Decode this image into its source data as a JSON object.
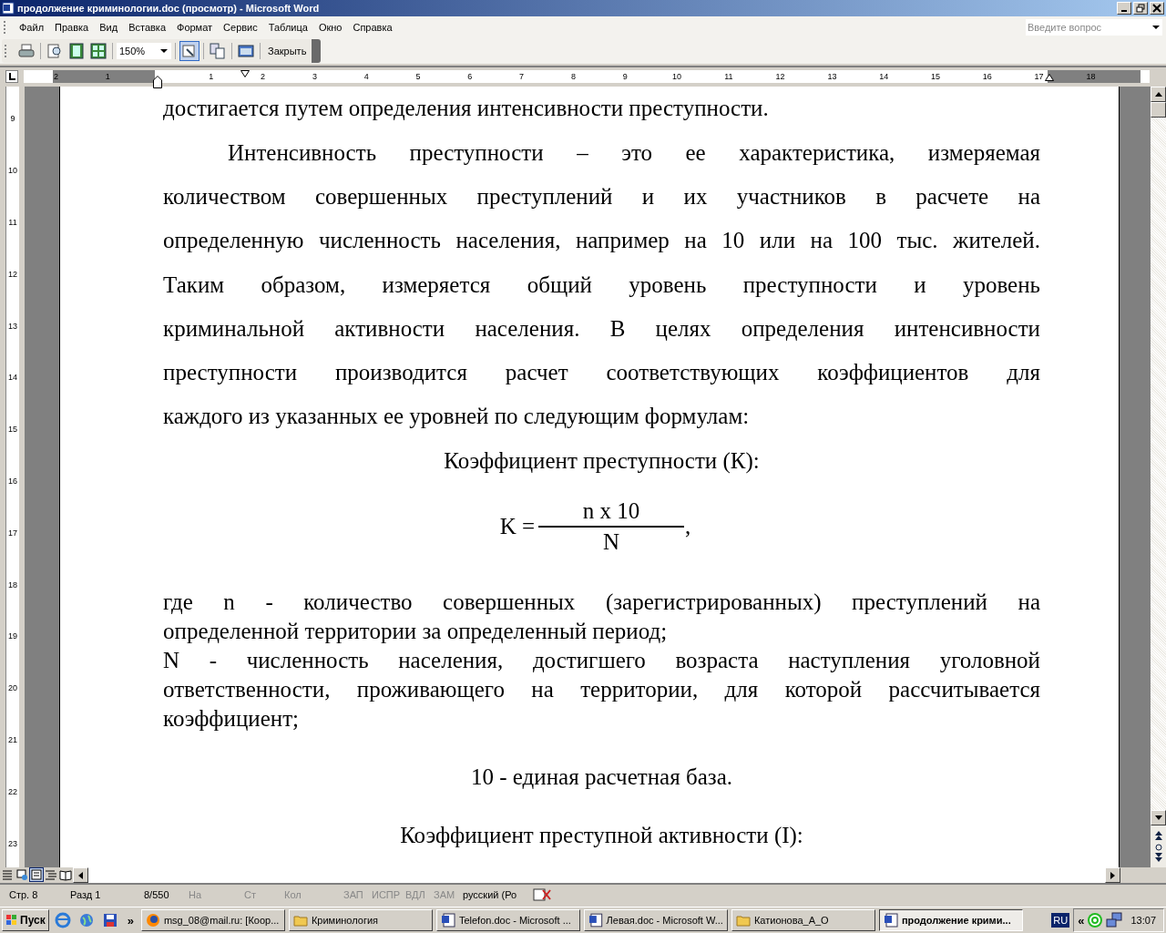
{
  "window": {
    "title": "продолжение криминологии.doc (просмотр) - Microsoft Word"
  },
  "menu": [
    {
      "label": "Файл"
    },
    {
      "label": "Правка"
    },
    {
      "label": "Вид"
    },
    {
      "label": "Вставка"
    },
    {
      "label": "Формат"
    },
    {
      "label": "Сервис"
    },
    {
      "label": "Таблица"
    },
    {
      "label": "Окно"
    },
    {
      "label": "Справка"
    }
  ],
  "help_box": {
    "placeholder": "Введите вопрос"
  },
  "toolbar": {
    "zoom": "150%",
    "magnifier_on": true,
    "close_label": "Закрыть"
  },
  "ruler": {
    "left_labels": [
      "2",
      "1"
    ],
    "labels": [
      "1",
      "2",
      "3",
      "4",
      "5",
      "6",
      "7",
      "8",
      "9",
      "10",
      "11",
      "12",
      "13",
      "14",
      "15",
      "16",
      "17"
    ],
    "right_labels": [
      "18"
    ],
    "vertical_labels": [
      "9",
      "10",
      "11",
      "12",
      "13",
      "14",
      "15",
      "16",
      "17",
      "18",
      "19",
      "20",
      "21",
      "22",
      "23"
    ]
  },
  "document": [
    {
      "kind": "continuation",
      "lines": [
        "достигается путем определения интенсивности преступности."
      ]
    },
    {
      "kind": "paragraph",
      "lines": [
        "Интенсивность преступности – это ее характеристика, измеряемая",
        "количеством совершенных преступлений и их участников в расчете на",
        "определенную численность населения, например на 10 или на 100 тыс. жителей.",
        "Таким образом, измеряется общий уровень преступности и уровень",
        "криминальной активности населения. В целях определения интенсивности",
        "преступности производится расчет соответствующих коэффициентов для",
        "каждого из указанных ее уровней по следующим формулам:"
      ]
    },
    {
      "kind": "heading",
      "text": "Коэффициент преступности (К):"
    },
    {
      "kind": "formula",
      "lhs": "K =",
      "numerator": "n x 10",
      "denominator": "N",
      "tail": ","
    },
    {
      "kind": "definition",
      "lines": [
        "где n - количество совершенных (зарегистрированных) преступлений на",
        "определенной территории за определенный период;"
      ]
    },
    {
      "kind": "definition",
      "lines": [
        "N - численность населения, достигшего возраста наступления уголовной",
        "ответственности, проживающего на территории, для которой рассчитывается",
        "коэффициент;"
      ]
    },
    {
      "kind": "caption",
      "text": "10 - единая расчетная база."
    },
    {
      "kind": "caption",
      "text": "Коэффициент преступной активности (I):"
    }
  ],
  "status_bar": [
    {
      "text": "Стр. 8",
      "on": true
    },
    {
      "text": "Разд 1",
      "on": true
    },
    {
      "text": "8/550",
      "on": true
    },
    {
      "text": "На",
      "on": false
    },
    {
      "text": "Ст",
      "on": false
    },
    {
      "text": "Кол",
      "on": false
    },
    {
      "text": "ЗАП",
      "on": false
    },
    {
      "text": "ИСПР",
      "on": false
    },
    {
      "text": "ВДЛ",
      "on": false
    },
    {
      "text": "ЗАМ",
      "on": false
    },
    {
      "text": "русский (Ро",
      "on": true
    }
  ],
  "taskbar": {
    "start": "Пуск",
    "more": "»",
    "tasks": [
      {
        "label": "msg_08@mail.ru: [Коор...",
        "kind": "browser",
        "selected": false
      },
      {
        "label": "Криминология",
        "kind": "folder",
        "selected": false
      },
      {
        "label": "Telefon.doc - Microsoft ...",
        "kind": "word",
        "selected": false
      },
      {
        "label": "Левая.doc - Microsoft W...",
        "kind": "word",
        "selected": false
      },
      {
        "label": "Катионова_А_О",
        "kind": "folder",
        "selected": false
      },
      {
        "label": "продолжение крими...",
        "kind": "word",
        "selected": true
      }
    ],
    "language": "RU",
    "tray_expand": "«",
    "clock": "13:07"
  }
}
